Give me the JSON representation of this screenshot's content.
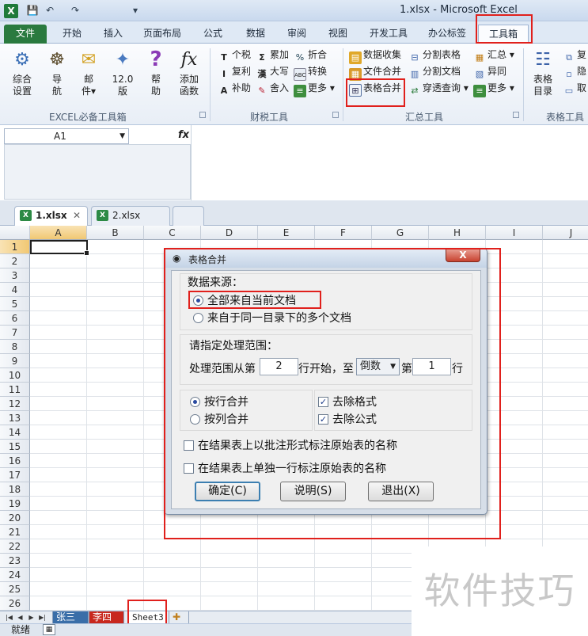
{
  "window": {
    "title": "1.xlsx - Microsoft Excel",
    "app_icon": "X"
  },
  "qat": {
    "save_icon": "💾",
    "undo_icon": "↶",
    "redo_icon": "↷",
    "more_icon": "▾"
  },
  "tabs": [
    {
      "label": "文件"
    },
    {
      "label": "开始"
    },
    {
      "label": "插入"
    },
    {
      "label": "页面布局"
    },
    {
      "label": "公式"
    },
    {
      "label": "数据"
    },
    {
      "label": "审阅"
    },
    {
      "label": "视图"
    },
    {
      "label": "开发工具"
    },
    {
      "label": "办公标签"
    },
    {
      "label": "工具箱"
    }
  ],
  "ribbon": {
    "group1": {
      "label": "EXCEL必备工具箱",
      "buttons": [
        {
          "line1": "综合",
          "line2": "设置"
        },
        {
          "line1": "导",
          "line2": "航"
        },
        {
          "line1": "邮",
          "line2": "件▾"
        },
        {
          "line1": "12.0",
          "line2": "版"
        },
        {
          "line1": "帮",
          "line2": "助"
        },
        {
          "line1": "添加",
          "line2": "函数"
        }
      ]
    },
    "group2": {
      "label": "财税工具",
      "items": [
        "个税",
        "复利",
        "补助",
        "累加",
        "大写",
        "舍入",
        "折合",
        "转换",
        "更多 ▾"
      ],
      "icons": [
        "T",
        "I",
        "A",
        "Σ",
        "漢",
        "✎",
        "%",
        "ABC",
        "≡"
      ]
    },
    "group3": {
      "label": "汇总工具",
      "items": [
        "数据收集",
        "文件合并",
        "表格合并",
        "分割表格",
        "分割文档",
        "穿透查询 ▾",
        "汇总 ▾",
        "异同",
        "更多 ▾"
      ]
    },
    "group4": {
      "label": "表格工具",
      "button": {
        "line1": "表格",
        "line2": "目录"
      },
      "small_items": [
        "复",
        "隐",
        "取"
      ]
    }
  },
  "formula_bar": {
    "cell_ref": "A1",
    "fx": "fx"
  },
  "doc_tabs": [
    {
      "label": "1.xlsx",
      "close": "✕"
    },
    {
      "label": "2.xlsx"
    }
  ],
  "columns": [
    "A",
    "B",
    "C",
    "D",
    "E",
    "F",
    "G",
    "H",
    "I",
    "J"
  ],
  "rows": [
    "1",
    "2",
    "3",
    "4",
    "5",
    "6",
    "7",
    "8",
    "9",
    "10",
    "11",
    "12",
    "13",
    "14",
    "15",
    "16",
    "17",
    "18",
    "19",
    "20",
    "21",
    "22",
    "23",
    "24",
    "25",
    "26"
  ],
  "sheet_tabs": [
    "张三",
    "李四",
    "Sheet3"
  ],
  "status": {
    "ready": "就绪"
  },
  "watermark": "软件技巧",
  "dialog": {
    "title": "表格合并",
    "close": "X",
    "source_label": "数据来源：",
    "source_opt1": "全部来自当前文档",
    "source_opt2": "来自于同一目录下的多个文档",
    "range_label": "请指定处理范围：",
    "range_from": "处理范围从第",
    "start_row": "2",
    "range_mid": "行开始，至",
    "range_mode": "倒数",
    "range_nth": "第",
    "end_row": "1",
    "range_row": "行",
    "merge_by_row": "按行合并",
    "merge_by_col": "按列合并",
    "remove_format": "去除格式",
    "remove_formula": "去除公式",
    "opt_comment": "在结果表上以批注形式标注原始表的名称",
    "opt_row": "在结果表上单独一行标注原始表的名称",
    "btn_ok": "确定(C)",
    "btn_help": "说明(S)",
    "btn_exit": "退出(X)"
  }
}
